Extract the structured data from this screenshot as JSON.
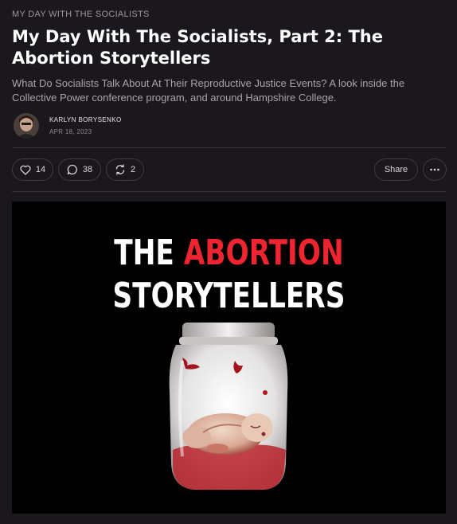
{
  "post": {
    "section": "MY DAY WITH THE SOCIALISTS",
    "title": "My Day With The Socialists, Part 2: The Abortion Storytellers",
    "subtitle": "What Do Socialists Talk About At Their Reproductive Justice Events? A look inside the Collective Power conference program, and around Hampshire College.",
    "author": "KARLYN BORYSENKO",
    "date": "APR 18, 2023"
  },
  "actions": {
    "likes": "14",
    "comments": "38",
    "restacks": "2",
    "share_label": "Share"
  },
  "hero": {
    "line1_part1": "THE ",
    "line1_part2": "ABORTION",
    "line2": "STORYTELLERS"
  },
  "colors": {
    "background": "#1a171d",
    "accent_red": "#ee2530",
    "divider": "#34303a"
  },
  "icons": [
    "heart-icon",
    "comment-icon",
    "restack-icon",
    "more-icon"
  ]
}
